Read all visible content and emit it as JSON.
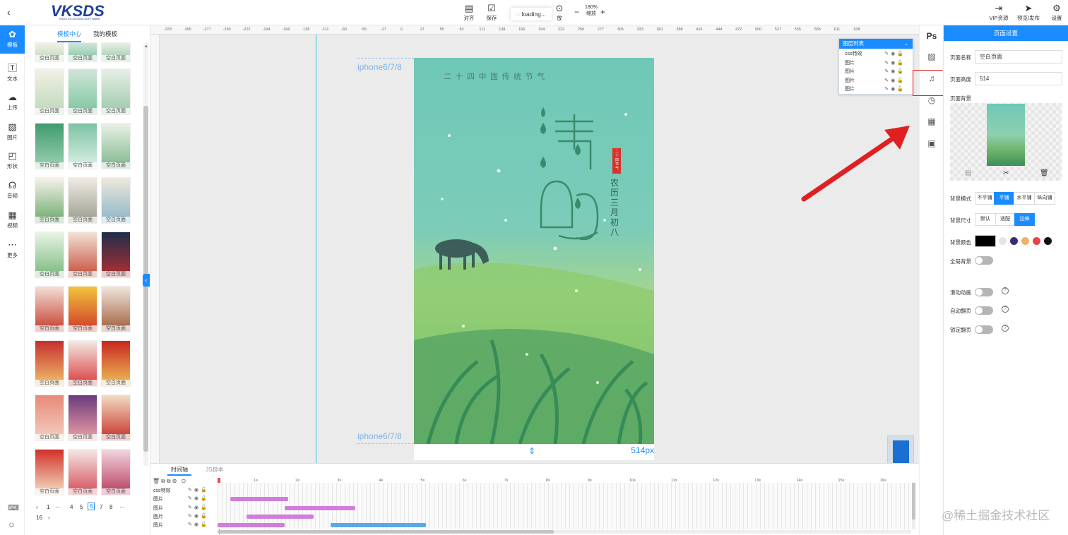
{
  "topbar": {
    "logo_text": "VKSDS",
    "logo_sub": "KSDS.XS-DESIGN-SOFTWARE",
    "tools": [
      {
        "label": "对齐",
        "icon": "align-icon"
      },
      {
        "label": "保存",
        "icon": "save-icon"
      },
      {
        "label": "",
        "icon": "history-icon"
      }
    ],
    "loading_text": "loading...",
    "zoom_value": "180%",
    "zoom_label": "缩放",
    "play_label": "放",
    "right_tools": [
      {
        "label": "VIP资源",
        "icon": "vip-icon"
      },
      {
        "label": "预览/发布",
        "icon": "send-icon"
      },
      {
        "label": "设置",
        "icon": "gear-icon"
      }
    ]
  },
  "rail": {
    "items": [
      {
        "label": "模板",
        "icon": "template-icon",
        "active": true
      },
      {
        "label": "文本",
        "icon": "text-icon"
      },
      {
        "label": "上传",
        "icon": "upload-icon"
      },
      {
        "label": "图片",
        "icon": "image-icon"
      },
      {
        "label": "形状",
        "icon": "shape-icon"
      },
      {
        "label": "音频",
        "icon": "audio-icon"
      },
      {
        "label": "视频",
        "icon": "video-icon"
      },
      {
        "label": "更多",
        "icon": "more-icon"
      }
    ]
  },
  "templates": {
    "tabs": [
      "模板中心",
      "我的模板"
    ],
    "caption": "空白页面",
    "pagination": [
      "1",
      "···",
      "4",
      "5",
      "6",
      "7",
      "8",
      "···",
      "16"
    ],
    "current_page": "6"
  },
  "canvas": {
    "device_top": "iphone6/7/8",
    "device_bottom": "iphone6/7/8",
    "height_label": "514px",
    "ruler_ticks": [
      "-333",
      "-305",
      "-277",
      "-250",
      "-222",
      "-194",
      "-166",
      "-138",
      "-111",
      "-83",
      "-55",
      "-27",
      "0",
      "27",
      "55",
      "83",
      "111",
      "138",
      "166",
      "194",
      "222",
      "250",
      "277",
      "305",
      "333",
      "361",
      "388",
      "416",
      "444",
      "472",
      "500",
      "527",
      "555",
      "583",
      "611",
      "638"
    ],
    "poster": {
      "top_line": "二 十 四 中 国 传 统 节 气",
      "title_chars": [
        "清",
        "明"
      ],
      "seal_text": "二十四节气",
      "side_text": "农历三月初八"
    }
  },
  "layers": {
    "title": "图层列表",
    "rows": [
      "css特效",
      "图片",
      "图片",
      "图片",
      "图片"
    ]
  },
  "right_icons": [
    "ps-icon",
    "texture-icon",
    "music-icon",
    "history-icon",
    "grid-icon",
    "picture-icon"
  ],
  "settings": {
    "title": "页面设置",
    "page_name_label": "页面名称",
    "page_name_value": "空白页面",
    "page_height_label": "页面高度",
    "page_height_value": "514",
    "bg_label": "页面背景",
    "bg_mode_label": "背景模式",
    "bg_mode_options": [
      "不平铺",
      "平铺",
      "水平铺",
      "纵向铺"
    ],
    "bg_mode_active": 1,
    "bg_size_label": "背景尺寸",
    "bg_size_options": [
      "默认",
      "适配",
      "拉伸"
    ],
    "bg_size_active": 2,
    "bg_color_label": "背景颜色",
    "bg_colors": [
      "#000000",
      "#dfe9e0",
      "#3b2a7a",
      "#f0b070",
      "#e04848",
      "#111111"
    ],
    "global_bg_label": "全局背景",
    "slide_anim_label": "滑动动画",
    "auto_flip_label": "自动翻页",
    "lock_flip_label": "锁定翻页"
  },
  "timeline": {
    "tabs": [
      "时间轴",
      "JS脚本"
    ],
    "rows": [
      "css特效",
      "图片",
      "图片",
      "图片",
      "图片"
    ],
    "ticks": [
      "1s",
      "2s",
      "3s",
      "4s",
      "5s",
      "6s",
      "7s",
      "8s",
      "9s",
      "10s",
      "11s",
      "12s",
      "13s",
      "14s",
      "15s",
      "16s"
    ],
    "bars": [
      {
        "row": 1,
        "start": 0.3,
        "end": 1.7,
        "color": "#d17ddb"
      },
      {
        "row": 2,
        "start": 1.6,
        "end": 3.3,
        "color": "#d17ddb"
      },
      {
        "row": 3,
        "start": 0.7,
        "end": 2.3,
        "color": "#d17ddb"
      },
      {
        "row": 4,
        "start": 0.0,
        "end": 1.6,
        "color": "#d17ddb"
      },
      {
        "row": 4,
        "start": 2.7,
        "end": 5.0,
        "color": "#5ba8e8"
      }
    ]
  },
  "watermark": "@稀土掘金技术社区"
}
